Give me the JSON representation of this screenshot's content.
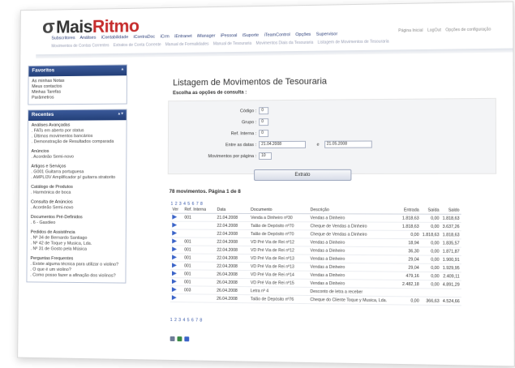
{
  "header": {
    "logo_mais": "Mais",
    "logo_ritmo": "Ritmo",
    "top_links": [
      "Página Inicial",
      "LogOut",
      "Opções de configuração"
    ],
    "menu": [
      "Subscritores",
      "Análises",
      "iContabilidade",
      "iContraDoc",
      "iCrm",
      "iEntranet",
      "iManager",
      "iPessoal",
      "iSuporte",
      "iTeamControl",
      "Opções",
      "Supervisor"
    ],
    "submenu": [
      "Movimentos de Contas Correntes",
      "Extratos de Conta Corrente",
      "Manual de Formalidades",
      "Manual de Tesouraria",
      "Movimentos Diais da Tesouraria",
      "Listagem de Movimentos de Tesouraria"
    ]
  },
  "sidebar": {
    "favoritos": {
      "title": "Favoritos",
      "items": [
        "As minhas Notas",
        "Meus contactos",
        "Minhas Tarefas",
        "Parâmetros"
      ]
    },
    "recentes": {
      "title": "Recentes",
      "groups": [
        {
          "title": "Análises Avançadas",
          "items": [
            ". FATs em aberto por status",
            ". Últimos movimentos bancários",
            ". Demonstração de Resultados comparada"
          ]
        },
        {
          "title": "Anúncios",
          "items": [
            ". Acordeão Semi-novo"
          ]
        },
        {
          "title": "Artigos e Serviços",
          "items": [
            ". G001 Guitarra portuguesa",
            ". AMPLI3V Amplificador p/ guitarra stratorito"
          ]
        },
        {
          "title": "Catálogo de Produtos",
          "items": [
            ". Harmónica de boca"
          ]
        },
        {
          "title": "Consulta de Anúncios",
          "items": [
            ". Acordeão Semi-novo"
          ]
        },
        {
          "title": "Documentos Pré-Definidos",
          "items": [
            ". 6 - Gasóleo"
          ]
        },
        {
          "title": "Pedidos de Assistência",
          "items": [
            ". Nº 34 de Bernardo Santiago",
            ". Nº 42 de Toque y Musica, Lda.",
            ". Nº 31 de Gosto pela Música"
          ]
        },
        {
          "title": "Perguntas Frequentes",
          "items": [
            ". Existe alguma técnica para utilizar o violino?",
            ". O que é um violino?",
            ". Como posso fazer a afinação dos violinos?"
          ]
        }
      ]
    }
  },
  "main": {
    "title": "Listagem de Movimentos de Tesouraria",
    "subtitle": "Escolha as opções de consulta :",
    "form": {
      "codigo_label": "Código :",
      "codigo_value": "0",
      "grupo_label": "Grupo :",
      "grupo_value": "0",
      "ref_label": "Ref. Interna :",
      "ref_value": "0",
      "datas_label": "Entre as datas :",
      "date_from": "21.04.2008",
      "date_sep": "e",
      "date_to": "21.05.2008",
      "mov_label": "Movimentos por página :",
      "mov_value": "10"
    },
    "button": "Extrato",
    "results_title": "78 movimentos. Página 1 de 8",
    "pager": "1 2 3 4 5 6 7 8",
    "columns": [
      "Ver",
      "Ref. Interna",
      "Data",
      "Documento",
      "Descrição",
      "Entrada",
      "Saída",
      "Saldo"
    ],
    "rows": [
      {
        "ref": "001",
        "data": "21.04.2008",
        "doc": "Venda a Dinheiro nº30",
        "desc": "Vendas a Dinheiro",
        "entrada": "1.818,63",
        "saida": "0,00",
        "saldo": "1.818,63"
      },
      {
        "ref": "",
        "data": "22.04.2008",
        "doc": "Talão de Depósito nº70",
        "desc": "Cheque de Vendas a Dinheiro",
        "entrada": "1.818,63",
        "saida": "0,00",
        "saldo": "3.637,26"
      },
      {
        "ref": "",
        "data": "22.04.2008",
        "doc": "Talão de Depósito nº70",
        "desc": "Cheque de Vendas a Dinheiro",
        "entrada": "0,00",
        "saida": "1.818,63",
        "saldo": "1.818,63"
      },
      {
        "ref": "001",
        "data": "22.04.2008",
        "doc": "VD Pré Via de Rei nº12",
        "desc": "Vendas a Dinheiro",
        "entrada": "18,94",
        "saida": "0,00",
        "saldo": "1.835,57"
      },
      {
        "ref": "001",
        "data": "22.04.2008",
        "doc": "VD Pré Via de Rei nº12",
        "desc": "Vendas a Dinheiro",
        "entrada": "36,30",
        "saida": "0,00",
        "saldo": "1.871,87"
      },
      {
        "ref": "001",
        "data": "22.04.2008",
        "doc": "VD Pré Via de Rei nº13",
        "desc": "Vendas a Dinheiro",
        "entrada": "29,04",
        "saida": "0,00",
        "saldo": "1.900,91"
      },
      {
        "ref": "001",
        "data": "22.04.2008",
        "doc": "VD Pré Via de Rei nº13",
        "desc": "Vendas a Dinheiro",
        "entrada": "29,04",
        "saida": "0,00",
        "saldo": "1.929,95"
      },
      {
        "ref": "001",
        "data": "26.04.2008",
        "doc": "VD Pré Via de Rei nº14",
        "desc": "Vendas a Dinheiro",
        "entrada": "479,16",
        "saida": "0,00",
        "saldo": "2.409,11"
      },
      {
        "ref": "001",
        "data": "26.04.2008",
        "doc": "VD Pré Via de Rei nº15",
        "desc": "Vendas a Dinheiro",
        "entrada": "2.482,18",
        "saida": "0,00",
        "saldo": "4.891,29"
      },
      {
        "ref": "003",
        "data": "26.04.2008",
        "doc": "Letra nº 4",
        "desc": "Desconto de letra a receber",
        "entrada": "",
        "saida": "",
        "saldo": ""
      },
      {
        "ref": "",
        "data": "26.04.2008",
        "doc": "Talão de Depósito nº76",
        "desc": "Cheque do Cliente Toque y Musica, Lda.",
        "entrada": "0,00",
        "saida": "366,63",
        "saldo": "4.524,66"
      }
    ]
  }
}
